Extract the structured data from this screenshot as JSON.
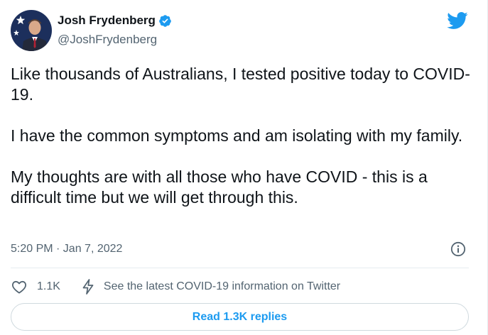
{
  "author": {
    "display_name": "Josh Frydenberg",
    "handle": "@JoshFrydenberg",
    "verified_icon": "verified-badge-icon",
    "avatar_icon": "avatar"
  },
  "brand": {
    "icon": "twitter-bird-icon",
    "color": "#1d9bf0"
  },
  "tweet": {
    "paragraphs": [
      "Like thousands of Australians, I tested positive today to COVID-19.",
      "I have the common symptoms and am isolating with my family.",
      "My thoughts are with all those who have COVID - this is a difficult time but we will get through this."
    ]
  },
  "meta": {
    "timestamp": "5:20 PM · Jan 7, 2022",
    "info_icon": "info-icon"
  },
  "actions": {
    "like_icon": "heart-icon",
    "like_count": "1.1K",
    "covid_icon": "lightning-bolt-icon",
    "covid_label": "See the latest COVID-19 information on Twitter"
  },
  "replies": {
    "button_label": "Read 1.3K replies"
  }
}
